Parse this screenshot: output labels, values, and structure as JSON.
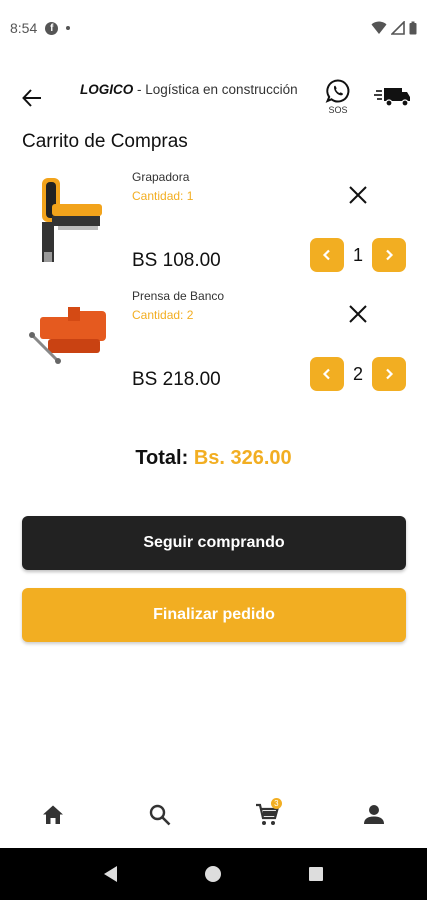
{
  "status_bar": {
    "time": "8:54",
    "notification_icon": "facebook-icon"
  },
  "header": {
    "brand_name": "LOGICO",
    "brand_tagline": " - Logística en construcción",
    "whatsapp_label": "SOS"
  },
  "page": {
    "title": "Carrito de Compras"
  },
  "cart": {
    "items": [
      {
        "name": "Grapadora",
        "quantity_label": "Cantidad: 1",
        "price": "BS 108.00",
        "quantity": "1",
        "image_icon": "nail-gun-image"
      },
      {
        "name": "Prensa de Banco",
        "quantity_label": "Cantidad: 2",
        "price": "BS 218.00",
        "quantity": "2",
        "image_icon": "bench-vise-image"
      }
    ],
    "total_label": "Total: ",
    "total_value": "Bs. 326.00"
  },
  "actions": {
    "continue_label": "Seguir comprando",
    "finish_label": "Finalizar pedido"
  },
  "bottom_nav": {
    "items": [
      "home-icon",
      "search-icon",
      "cart-icon",
      "profile-icon"
    ],
    "cart_badge": "3"
  },
  "colors": {
    "accent": "#f2ae22",
    "dark_button": "#222222",
    "text": "#111111"
  }
}
